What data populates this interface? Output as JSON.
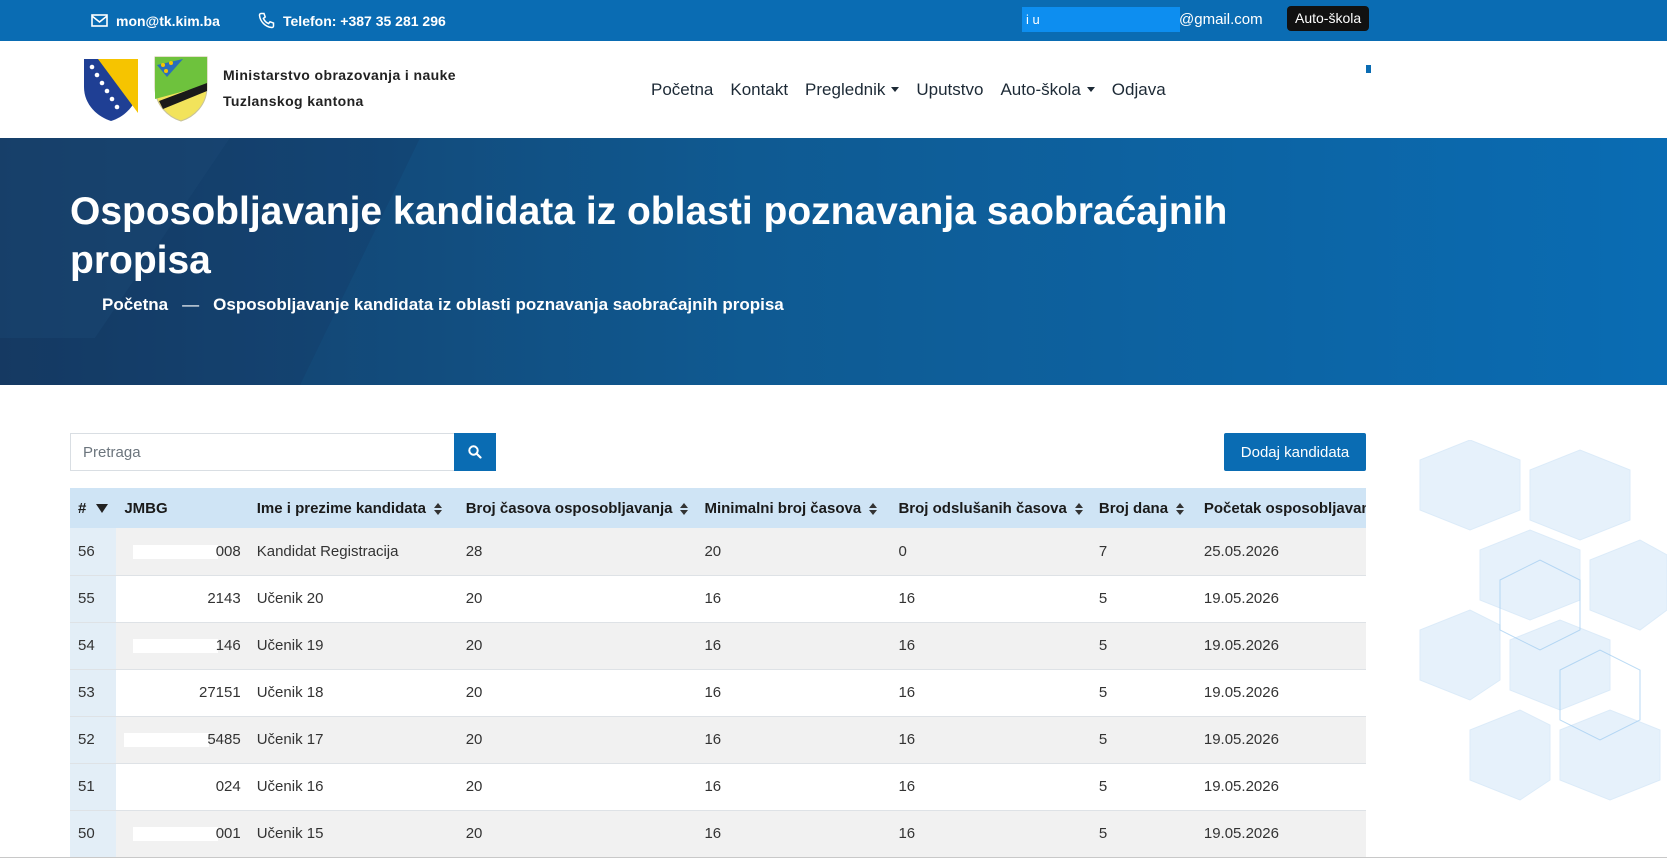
{
  "topbar": {
    "email": "mon@tk.kim.ba",
    "phone": "Telefon: +387 35 281 296",
    "user_prefix": "i u",
    "user_domain": "@gmail.com",
    "role_badge": "Auto-škola"
  },
  "header": {
    "ministry_line1": "Ministarstvo obrazovanja i nauke",
    "ministry_line2": "Tuzlanskog kantona",
    "nav": [
      {
        "label": "Početna"
      },
      {
        "label": "Kontakt"
      },
      {
        "label": "Preglednik"
      },
      {
        "label": "Uputstvo"
      },
      {
        "label": "Auto-škola"
      },
      {
        "label": "Odjava"
      }
    ]
  },
  "hero": {
    "title": "Osposobljavanje kandidata iz oblasti poznavanja saobraćajnih propisa",
    "breadcrumb_home": "Početna",
    "breadcrumb_sep": "—",
    "breadcrumb_current": "Osposobljavanje kandidata iz oblasti poznavanja saobraćajnih propisa"
  },
  "toolbar": {
    "search_placeholder": "Pretraga",
    "add_label": "Dodaj kandidata"
  },
  "table": {
    "headers": [
      "#",
      "JMBG",
      "Ime i prezime kandidata",
      "Broj časova osposobljavanja",
      "Minimalni broj časova",
      "Broj odslušanih časova",
      "Broj dana",
      "Početak osposobljavanja"
    ],
    "rows": [
      [
        "56",
        "008",
        "Kandidat Registracija",
        "28",
        "20",
        "0",
        "7",
        "25.05.2026"
      ],
      [
        "55",
        "2143",
        "Učenik 20",
        "20",
        "16",
        "16",
        "5",
        "19.05.2026"
      ],
      [
        "54",
        "146",
        "Učenik 19",
        "20",
        "16",
        "16",
        "5",
        "19.05.2026"
      ],
      [
        "53",
        "27151",
        "Učenik 18",
        "20",
        "16",
        "16",
        "5",
        "19.05.2026"
      ],
      [
        "52",
        "5485",
        "Učenik 17",
        "20",
        "16",
        "16",
        "5",
        "19.05.2026"
      ],
      [
        "51",
        "024",
        "Učenik 16",
        "20",
        "16",
        "16",
        "5",
        "19.05.2026"
      ],
      [
        "50",
        "001",
        "Učenik 15",
        "20",
        "16",
        "16",
        "5",
        "19.05.2026"
      ]
    ]
  },
  "colors": {
    "primary": "#0a6cb3",
    "hero_dark": "#163b63",
    "table_header": "#cfe4f5"
  }
}
